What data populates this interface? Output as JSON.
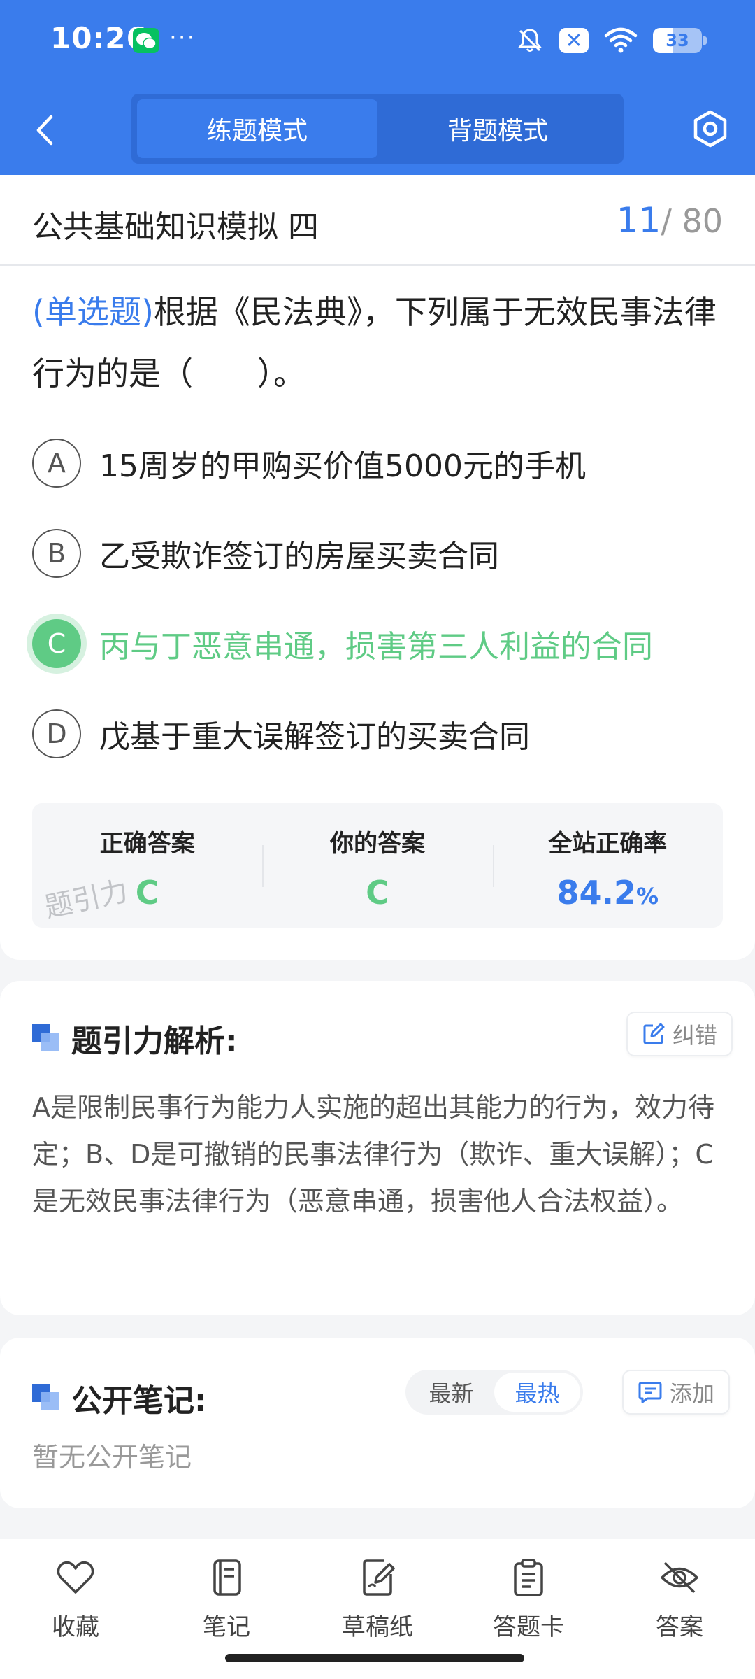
{
  "status_bar": {
    "time": "10:26",
    "more": "···",
    "battery": "33",
    "icons": [
      "wechat-icon",
      "mute-icon",
      "x-badge-icon",
      "wifi-icon",
      "battery-icon"
    ]
  },
  "nav": {
    "back_icon": "chevron-left-icon",
    "modes": [
      "练题模式",
      "背题模式"
    ],
    "active_mode": "练题模式",
    "settings_icon": "settings-icon"
  },
  "question": {
    "paper_title": "公共基础知识模拟 四",
    "current": "11",
    "total": "/ 80",
    "type": "(单选题)",
    "stem": "根据《民法典》，下列属于无效民事法律行为的是（　　）。",
    "options": [
      {
        "letter": "A",
        "text": "15周岁的甲购买价值5000元的手机"
      },
      {
        "letter": "B",
        "text": "乙受欺诈签订的房屋买卖合同"
      },
      {
        "letter": "C",
        "text": "丙与丁恶意串通，损害第三人利益的合同"
      },
      {
        "letter": "D",
        "text": "戊基于重大误解签订的买卖合同"
      }
    ],
    "selected": "C",
    "correct": "C"
  },
  "answer_summary": {
    "correct_label": "正确答案",
    "correct_value": "C",
    "yours_label": "你的答案",
    "yours_value": "C",
    "rate_label": "全站正确率",
    "rate_value": "84.2",
    "rate_unit": "%",
    "watermark": "题引力"
  },
  "analysis": {
    "title": "题引力解析:",
    "report_button": "纠错",
    "text": "A是限制民事行为能力人实施的超出其能力的行为，效力待定；B、D是可撤销的民事法律行为（欺诈、重大误解）；C是无效民事法律行为（恶意串通，损害他人合法权益）。"
  },
  "notes": {
    "title": "公开笔记:",
    "sort_options": [
      "最新",
      "最热"
    ],
    "active_sort": "最热",
    "add_button": "添加",
    "empty_text": "暂无公开笔记"
  },
  "bottom_tabs": [
    {
      "label": "收藏",
      "icon": "heart-icon"
    },
    {
      "label": "笔记",
      "icon": "notebook-icon"
    },
    {
      "label": "草稿纸",
      "icon": "draft-icon"
    },
    {
      "label": "答题卡",
      "icon": "answer-sheet-icon"
    },
    {
      "label": "答案",
      "icon": "eye-off-icon"
    }
  ],
  "colors": {
    "primary": "#3a7cec",
    "correct": "#5fcb85",
    "background": "#f4f5f7"
  }
}
